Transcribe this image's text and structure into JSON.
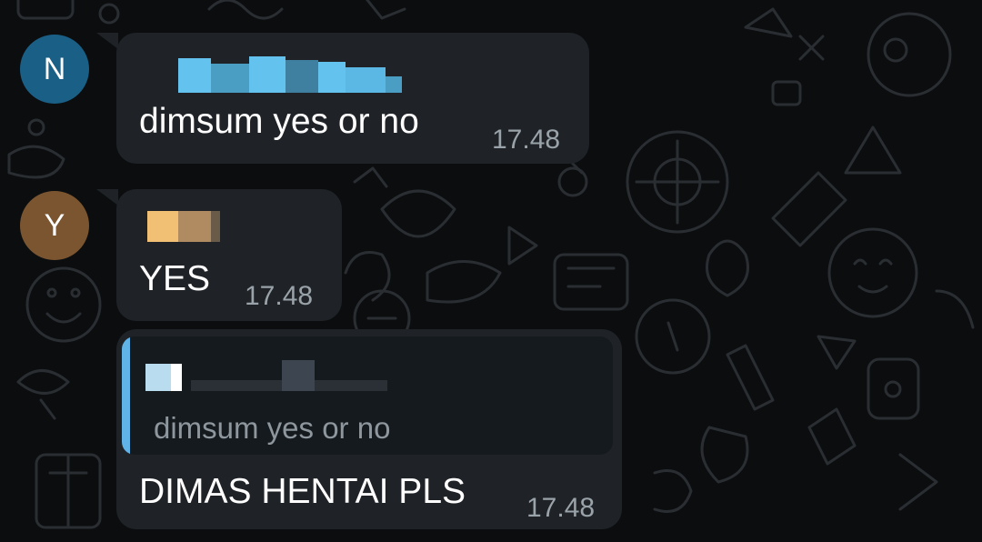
{
  "colors": {
    "background": "#0b0d0f",
    "bubble": "#1f2327",
    "reply_bar": "#5fb3e6",
    "avatar_n": "#1a5f86",
    "avatar_y": "#7a5530"
  },
  "messages": [
    {
      "avatar_letter": "N",
      "text": "dimsum yes or no",
      "time": "17.48"
    },
    {
      "avatar_letter": "Y",
      "text": "YES",
      "time": "17.48"
    },
    {
      "reply_quote": "dimsum yes or no",
      "text": "DIMAS HENTAI PLS",
      "time": "17.48"
    }
  ]
}
